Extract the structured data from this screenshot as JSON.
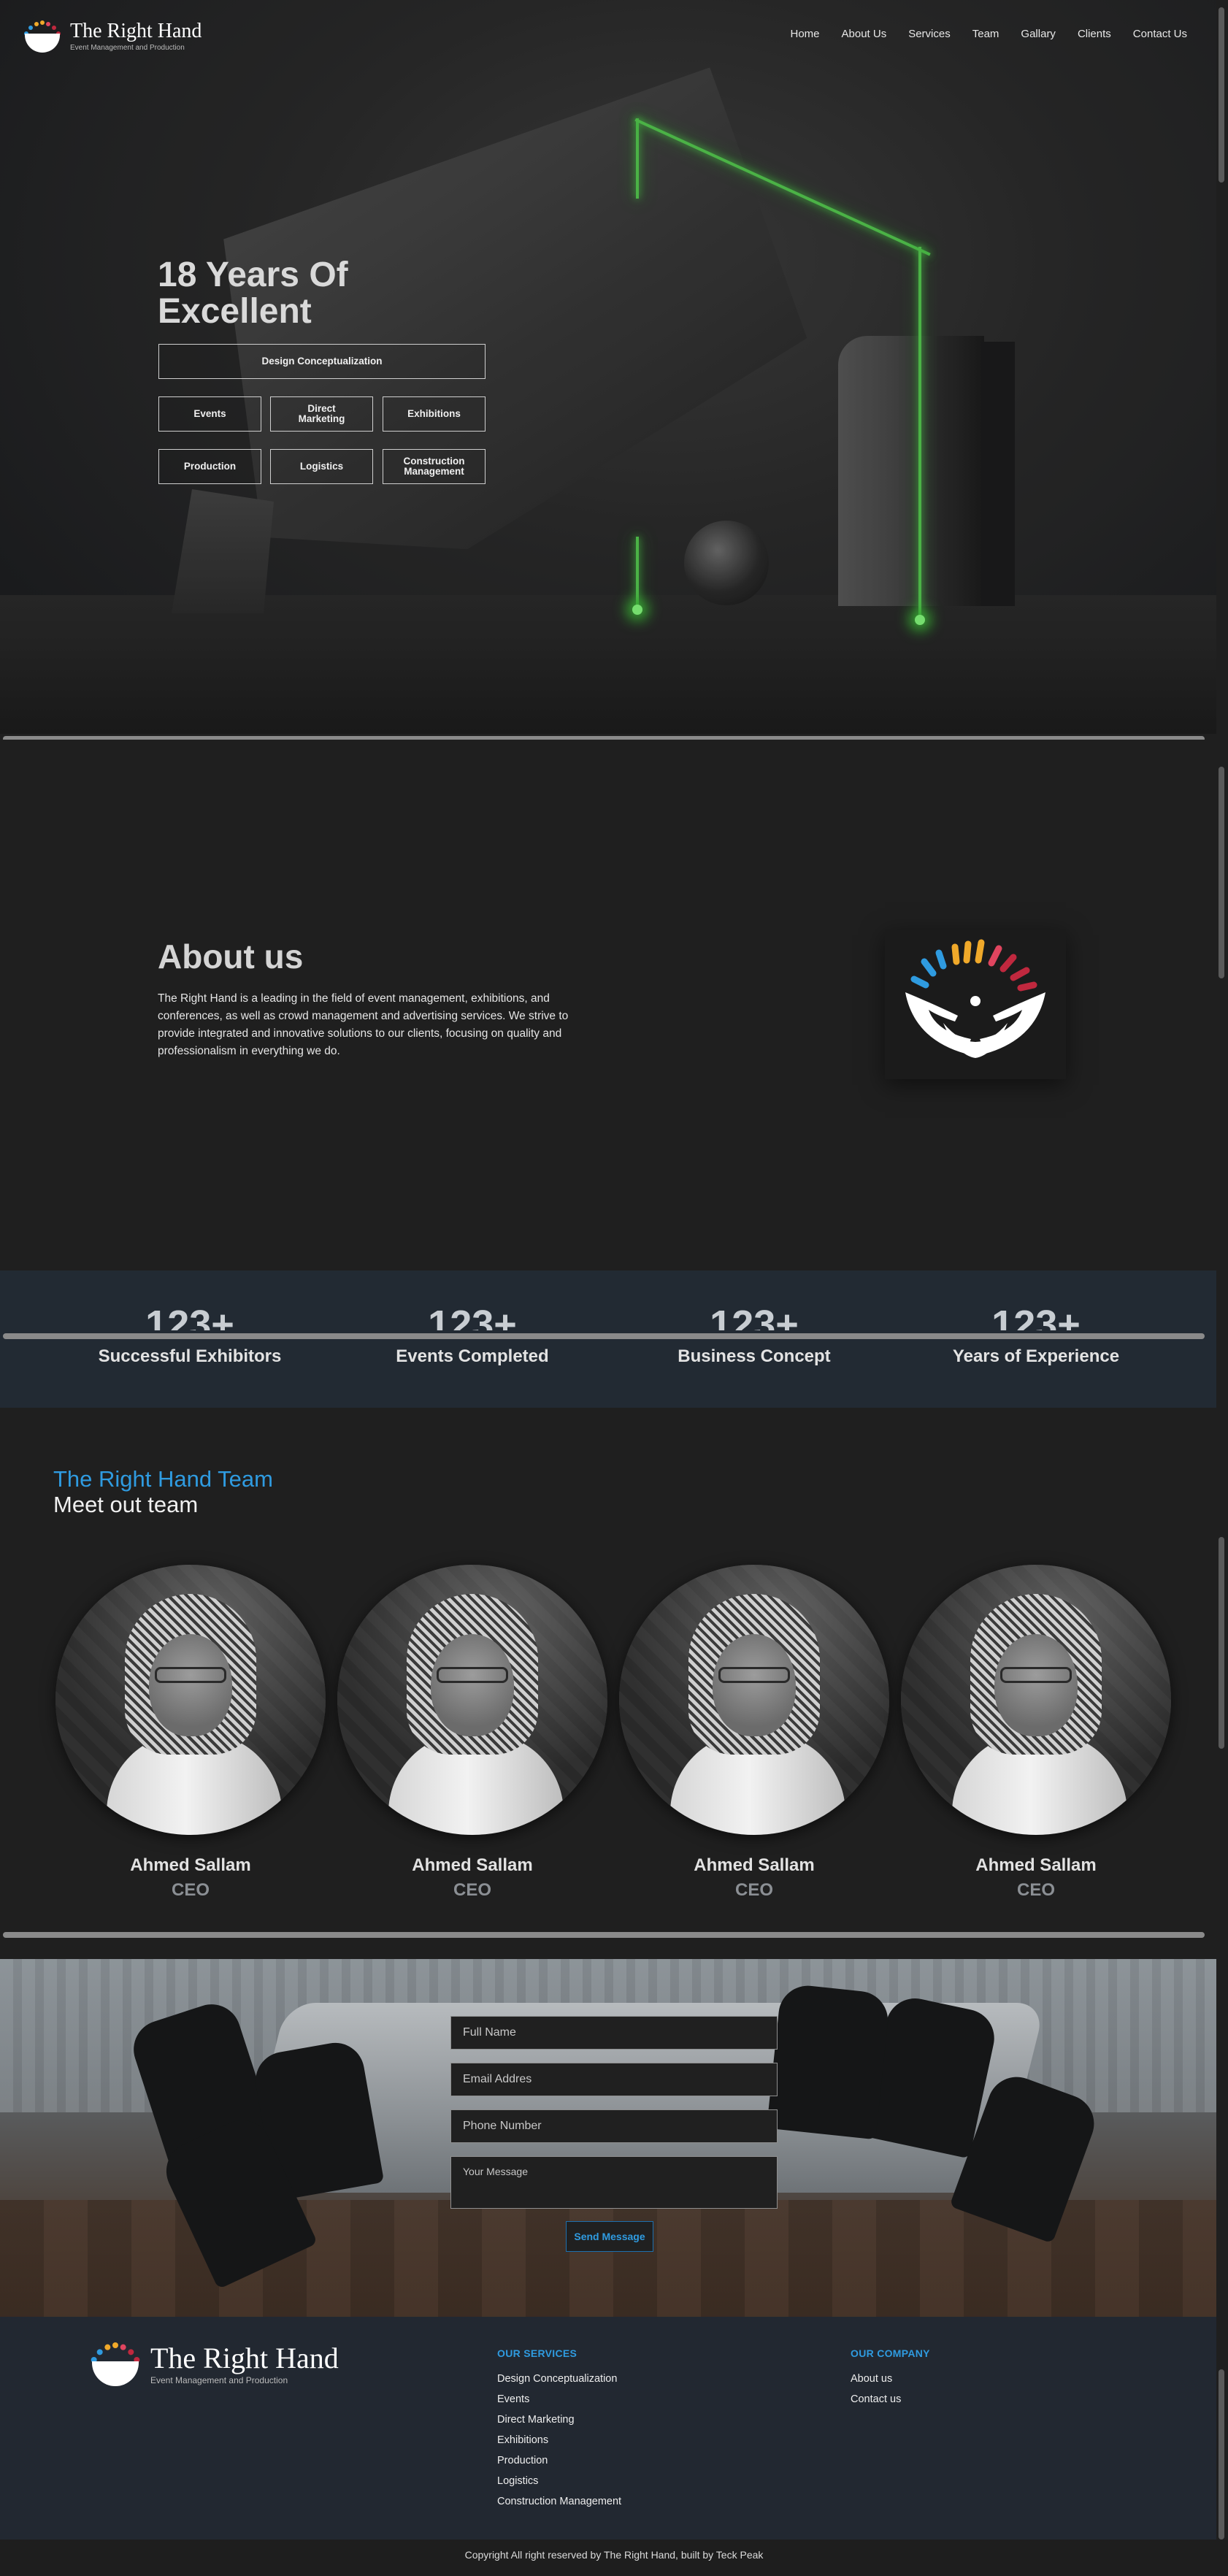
{
  "brand": {
    "name": "The Right Hand",
    "tagline": "Event Management and Production"
  },
  "nav": {
    "items": [
      "Home",
      "About Us",
      "Services",
      "Team",
      "Gallary",
      "Clients",
      "Contact Us"
    ]
  },
  "hero": {
    "title": "18 Years Of Excellent",
    "services": [
      "Design Conceptualization",
      "Events",
      "Direct Marketing",
      "Exhibitions",
      "Production",
      "Logistics",
      "Construction Management"
    ]
  },
  "about": {
    "title": "About us",
    "text": "The Right Hand is a leading in the field of event management, exhibitions, and conferences, as well as crowd management and advertising services. We strive to provide integrated and innovative solutions to our clients, focusing on quality and professionalism in everything we do."
  },
  "stats": [
    {
      "number": "123+",
      "label": "Successful Exhibitors"
    },
    {
      "number": "123+",
      "label": "Events Completed"
    },
    {
      "number": "123+",
      "label": "Business Concept"
    },
    {
      "number": "123+",
      "label": "Years of Experience"
    }
  ],
  "team": {
    "subtitle": "The Right Hand Team",
    "title": "Meet out team",
    "members": [
      {
        "name": "Ahmed Sallam",
        "role": "CEO"
      },
      {
        "name": "Ahmed Sallam",
        "role": "CEO"
      },
      {
        "name": "Ahmed Sallam",
        "role": "CEO"
      },
      {
        "name": "Ahmed Sallam",
        "role": "CEO"
      }
    ]
  },
  "contact": {
    "full_name_placeholder": "Full Name",
    "email_placeholder": "Email Addres",
    "phone_placeholder": "Phone Number",
    "message_placeholder": "Your Message",
    "send_label": "Send Message"
  },
  "footer": {
    "services_title": "OUR SERVICES",
    "services": [
      "Design Conceptualization",
      "Events",
      "Direct Marketing",
      "Exhibitions",
      "Production",
      "Logistics",
      "Construction Management"
    ],
    "company_title": "OUR COMPANY",
    "company": [
      "About us",
      "Contact us"
    ],
    "copyright": "Copyright All right reserved by The Right Hand, built by Teck Peak"
  },
  "colors": {
    "accent": "#2f9be0",
    "neon": "#52c24d",
    "footer_bg": "#222831",
    "stats_bg": "#222a33"
  }
}
